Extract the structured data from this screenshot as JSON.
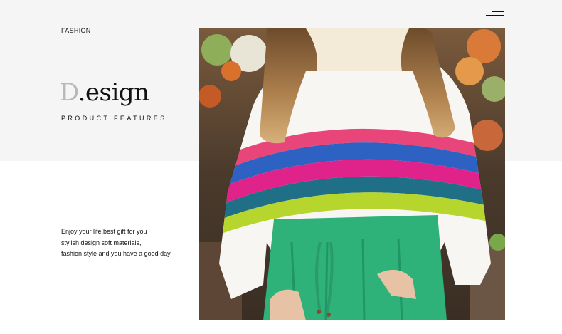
{
  "header": {
    "category_label": "FASHION",
    "menu_icon": "hamburger-menu-icon"
  },
  "hero": {
    "headline_initial": "D",
    "headline_rest": ".esign",
    "subheadline": "PRODUCT FEATURES"
  },
  "description": {
    "lines": [
      "Enjoy your life,best gift for you",
      "stylish design soft materials,",
      "fashion style and you have a good day"
    ]
  },
  "colors": {
    "band_background": "#f5f5f5",
    "page_background": "#ffffff",
    "text": "#111111",
    "headline_initial": "#b8b8b8"
  }
}
